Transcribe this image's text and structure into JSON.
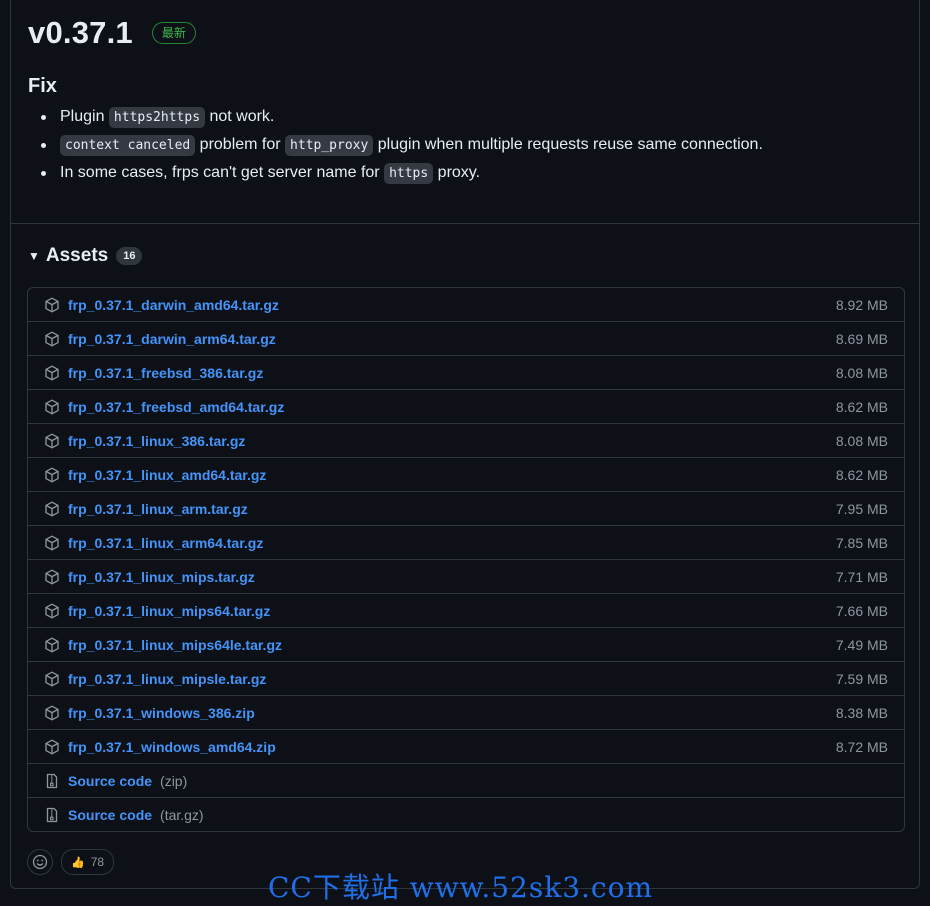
{
  "release": {
    "version": "v0.37.1",
    "latest_badge": "最新",
    "section_title": "Fix"
  },
  "notes": [
    {
      "before": "Plugin ",
      "code": "https2https",
      "after": " not work."
    },
    {
      "before": "",
      "code": "context canceled",
      "after": " problem for ",
      "code2": "http_proxy",
      "after2": " plugin when multiple requests reuse same connection."
    },
    {
      "before": "In some cases, frps can't get server name for ",
      "code": "https",
      "after": " proxy."
    }
  ],
  "assets": {
    "title": "Assets",
    "count": "16",
    "files": [
      {
        "name": "frp_0.37.1_darwin_amd64.tar.gz",
        "size": "8.92 MB"
      },
      {
        "name": "frp_0.37.1_darwin_arm64.tar.gz",
        "size": "8.69 MB"
      },
      {
        "name": "frp_0.37.1_freebsd_386.tar.gz",
        "size": "8.08 MB"
      },
      {
        "name": "frp_0.37.1_freebsd_amd64.tar.gz",
        "size": "8.62 MB"
      },
      {
        "name": "frp_0.37.1_linux_386.tar.gz",
        "size": "8.08 MB"
      },
      {
        "name": "frp_0.37.1_linux_amd64.tar.gz",
        "size": "8.62 MB"
      },
      {
        "name": "frp_0.37.1_linux_arm.tar.gz",
        "size": "7.95 MB"
      },
      {
        "name": "frp_0.37.1_linux_arm64.tar.gz",
        "size": "7.85 MB"
      },
      {
        "name": "frp_0.37.1_linux_mips.tar.gz",
        "size": "7.71 MB"
      },
      {
        "name": "frp_0.37.1_linux_mips64.tar.gz",
        "size": "7.66 MB"
      },
      {
        "name": "frp_0.37.1_linux_mips64le.tar.gz",
        "size": "7.49 MB"
      },
      {
        "name": "frp_0.37.1_linux_mipsle.tar.gz",
        "size": "7.59 MB"
      },
      {
        "name": "frp_0.37.1_windows_386.zip",
        "size": "8.38 MB"
      },
      {
        "name": "frp_0.37.1_windows_amd64.zip",
        "size": "8.72 MB"
      }
    ],
    "source": [
      {
        "label": "Source code",
        "suffix": "(zip)"
      },
      {
        "label": "Source code",
        "suffix": "(tar.gz)"
      }
    ]
  },
  "reactions": {
    "thumbs_up_count": "78",
    "thumbs_up_emoji": "👍"
  },
  "watermark": "CC下载站 www.52sk3.com",
  "colors": {
    "background": "#0d1117",
    "link": "#4493f8",
    "badge_green": "#3fb950",
    "muted": "#8d96a0"
  }
}
